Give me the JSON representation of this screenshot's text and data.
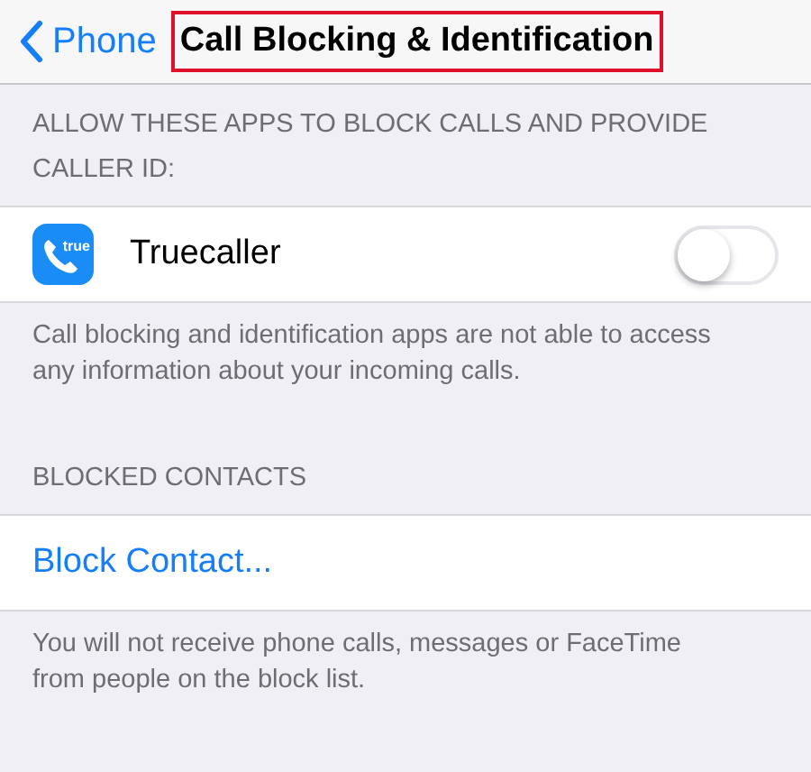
{
  "nav": {
    "back_label": "Phone",
    "title": "Call Blocking & Identification",
    "title_highlighted": true
  },
  "sections": [
    {
      "header": "ALLOW THESE APPS TO BLOCK CALLS AND PROVIDE CALLER ID:",
      "rows": [
        {
          "kind": "toggle",
          "label": "Truecaller",
          "icon_text": "true",
          "on": false
        }
      ],
      "footer": "Call blocking and identification apps are not able to access any information about your incoming calls."
    },
    {
      "header": "BLOCKED CONTACTS",
      "rows": [
        {
          "kind": "action",
          "label": "Block Contact..."
        }
      ],
      "footer": "You will not receive phone calls, messages or FaceTime from people on the block list."
    }
  ]
}
